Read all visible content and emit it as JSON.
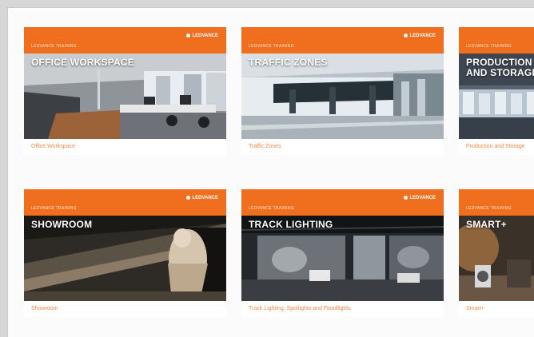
{
  "brand": {
    "name": "LEDVANCE"
  },
  "theme": {
    "accent": "#ef6f1f",
    "caption_color": "#f08a4b",
    "page_bg": "#fbfbfb"
  },
  "cards": [
    {
      "kicker": "LEDVANCE TRAINING",
      "title": "OFFICE WORKSPACE",
      "caption": "Office Workspace",
      "scene": "office-photo"
    },
    {
      "kicker": "LEDVANCE TRAINING",
      "title": "TRAFFIC ZONES",
      "caption": "Traffic Zones",
      "scene": "traffic-photo"
    },
    {
      "kicker": "LEDVANCE TRAINING",
      "title": "PRODUCTION\nAND STORAGE",
      "caption": "Production and Storage",
      "scene": "production-photo"
    },
    {
      "kicker": "LEDVANCE TRAINING",
      "title": "SHOWROOM",
      "caption": "Showroom",
      "scene": "showroom-photo"
    },
    {
      "kicker": "LEDVANCE TRAINING",
      "title": "TRACK LIGHTING",
      "caption": "Track Lighting, Spotlights and Floodlights",
      "scene": "track-photo"
    },
    {
      "kicker": "LEDVANCE TRAINING",
      "title": "SMART+",
      "caption": "Smart+",
      "scene": "smart-photo"
    }
  ]
}
